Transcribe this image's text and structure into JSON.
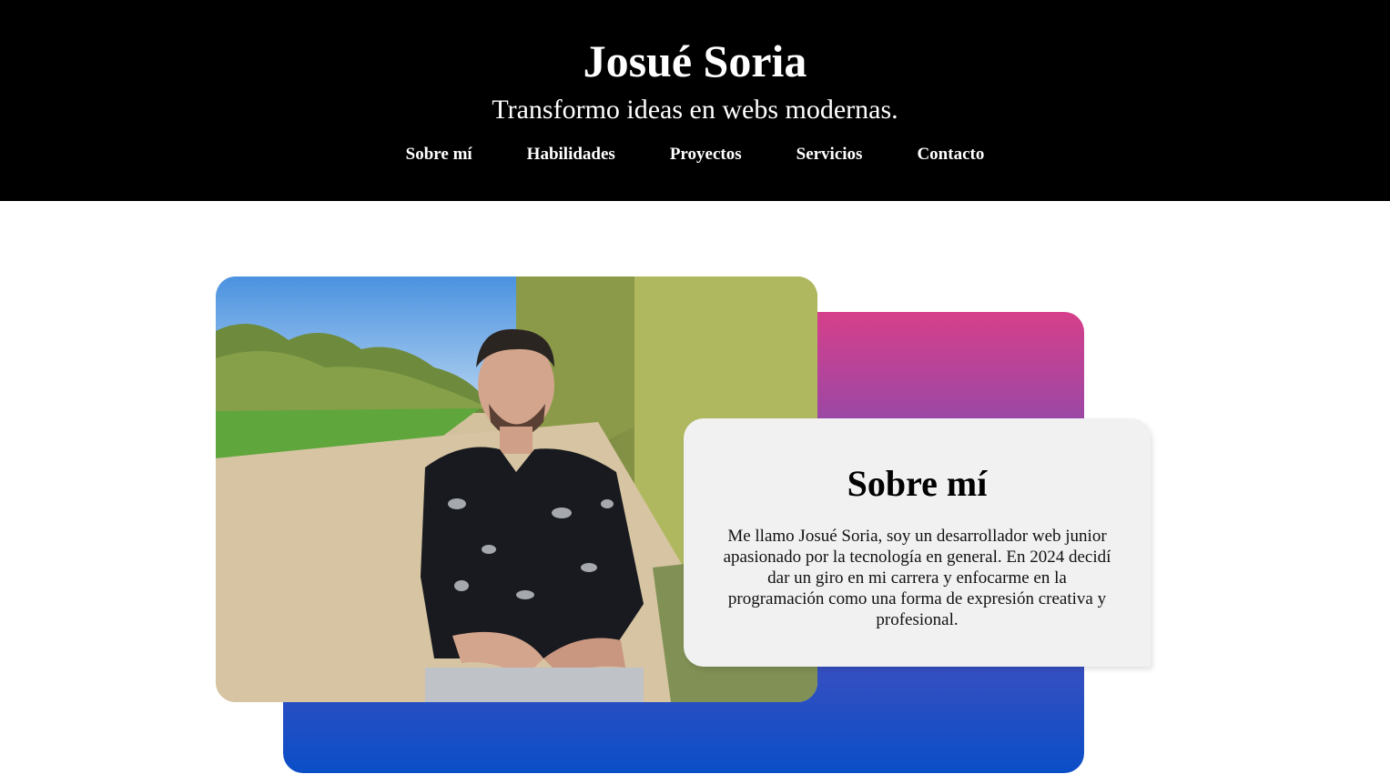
{
  "header": {
    "title": "Josué Soria",
    "tagline": "Transformo ideas en webs modernas."
  },
  "nav": {
    "items": [
      {
        "label": "Sobre mí"
      },
      {
        "label": "Habilidades"
      },
      {
        "label": "Proyectos"
      },
      {
        "label": "Servicios"
      },
      {
        "label": "Contacto"
      }
    ]
  },
  "about": {
    "heading": "Sobre mí",
    "paragraph": "Me llamo Josué Soria, soy un desarrollador web junior apasionado por la tecnología en general. En 2024 decidí dar un giro en mi carrera y enfocarme en la programación como una forma de expresión creativa y profesional."
  },
  "colors": {
    "header_bg": "#000000",
    "gradient_top": "#d63f8a",
    "gradient_bottom": "#0a4ec7",
    "card_bg": "#f1f1f1"
  }
}
